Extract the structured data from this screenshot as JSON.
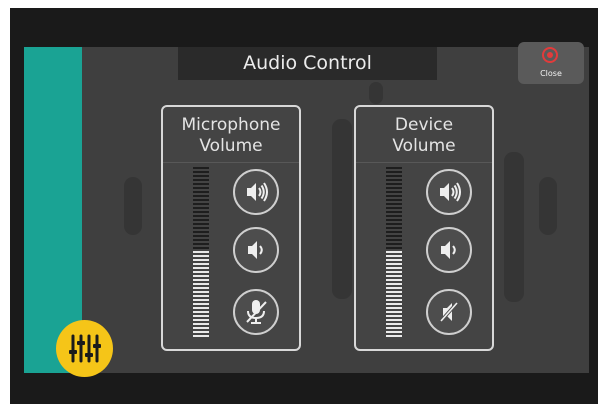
{
  "header": {
    "title": "Audio Control"
  },
  "close_button": {
    "label": "Close",
    "icon": "close-circle-icon",
    "color": "#e23b3b"
  },
  "microphone": {
    "title_line1": "Microphone",
    "title_line2": "Volume",
    "level": 0.5,
    "buttons": [
      "volume-up-icon",
      "volume-down-icon",
      "mic-mute-icon"
    ]
  },
  "device": {
    "title_line1": "Device",
    "title_line2": "Volume",
    "level": 0.5,
    "buttons": [
      "volume-up-icon",
      "volume-down-icon",
      "speaker-mute-icon"
    ]
  },
  "colors": {
    "accent_teal": "#1aa394",
    "mixer_yellow": "#f5c518"
  },
  "fab": {
    "icon": "mixer-sliders-icon"
  }
}
